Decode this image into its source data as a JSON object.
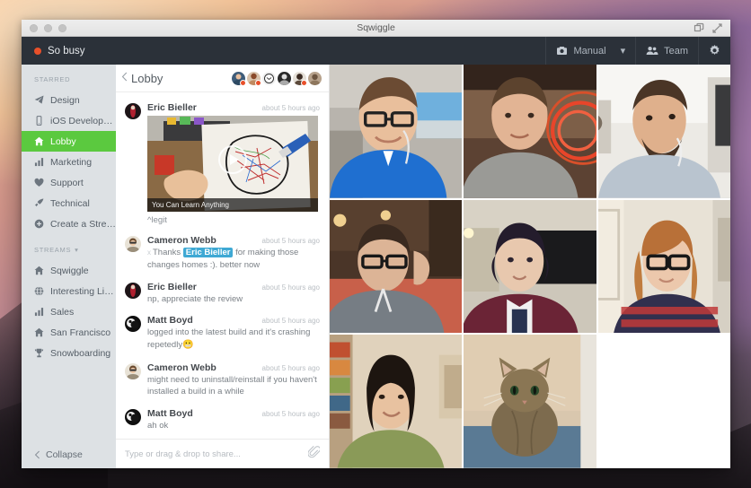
{
  "window": {
    "title": "Sqwiggle",
    "restore_icon": "restore-icon",
    "fullscreen_icon": "fullscreen-icon"
  },
  "toolbar": {
    "status_label": "So busy",
    "status_color": "#e8502a",
    "camera_icon": "camera-icon",
    "mode_label": "Manual",
    "mode_caret": "▾",
    "team_icon": "people-icon",
    "team_label": "Team",
    "settings_icon": "gear-icon"
  },
  "sidebar": {
    "starred_heading": "STARRED",
    "starred_items": [
      {
        "label": "Design",
        "icon": "paper-plane-icon",
        "active": false
      },
      {
        "label": "iOS Development",
        "icon": "phone-icon",
        "active": false
      },
      {
        "label": "Lobby",
        "icon": "home-icon",
        "active": true
      },
      {
        "label": "Marketing",
        "icon": "bar-chart-icon",
        "active": false
      },
      {
        "label": "Support",
        "icon": "heart-icon",
        "active": false
      },
      {
        "label": "Technical",
        "icon": "rocket-icon",
        "active": false
      },
      {
        "label": "Create a Stream",
        "icon": "plus-circle-icon",
        "active": false
      }
    ],
    "streams_heading": "STREAMS",
    "streams_caret": "▾",
    "streams_items": [
      {
        "label": "Sqwiggle",
        "icon": "home-icon"
      },
      {
        "label": "Interesting Links",
        "icon": "globe-icon"
      },
      {
        "label": "Sales",
        "icon": "bar-chart-icon"
      },
      {
        "label": "San Francisco",
        "icon": "home-icon"
      },
      {
        "label": "Snowboarding",
        "icon": "trophy-icon"
      }
    ],
    "collapse_label": "Collapse",
    "collapse_icon": "chevron-left-icon",
    "active_color": "#5bc93f"
  },
  "chat": {
    "back_icon": "chevron-left-icon",
    "title": "Lobby",
    "header_avatars": [
      {
        "name": "avatar-1",
        "has_badge": true
      },
      {
        "name": "avatar-2",
        "has_badge": true
      },
      {
        "name": "avatar-3",
        "has_badge": false
      },
      {
        "name": "avatar-4",
        "has_badge": false
      },
      {
        "name": "avatar-5",
        "has_badge": true
      },
      {
        "name": "avatar-6",
        "has_badge": false
      }
    ],
    "messages": [
      {
        "author": "Eric Bieller",
        "time": "about 5 hours ago",
        "media_caption": "You Can Learn Anything",
        "text": "^legit"
      },
      {
        "author": "Cameron Webb",
        "time": "about 5 hours ago",
        "prefix": "x",
        "text_before": "Thanks",
        "mention": "Eric Bieller",
        "text_after": "for making those changes homes :). better now"
      },
      {
        "author": "Eric Bieller",
        "time": "about 5 hours ago",
        "text": "np, appreciate the review"
      },
      {
        "author": "Matt Boyd",
        "time": "about 5 hours ago",
        "text": "logged into the latest build and it's crashing repetedly",
        "emoji": "😬"
      },
      {
        "author": "Cameron Webb",
        "time": "about 5 hours ago",
        "text": "might need to uninstall/reinstall if you haven't installed a build in a while"
      },
      {
        "author": "Matt Boyd",
        "time": "about 5 hours ago",
        "text": "ah ok"
      }
    ],
    "composer_placeholder": "Type or drag & drop to share...",
    "attach_icon": "paperclip-icon",
    "mention_color": "#3fa9d4"
  },
  "video_grid": {
    "tiles": [
      {
        "name": "video-tile-1",
        "occupied": true
      },
      {
        "name": "video-tile-2",
        "occupied": true
      },
      {
        "name": "video-tile-3",
        "occupied": true
      },
      {
        "name": "video-tile-4",
        "occupied": true
      },
      {
        "name": "video-tile-5",
        "occupied": true
      },
      {
        "name": "video-tile-6",
        "occupied": true
      },
      {
        "name": "video-tile-7",
        "occupied": true
      },
      {
        "name": "video-tile-8",
        "occupied": true
      },
      {
        "name": "video-tile-9",
        "occupied": false
      }
    ]
  }
}
